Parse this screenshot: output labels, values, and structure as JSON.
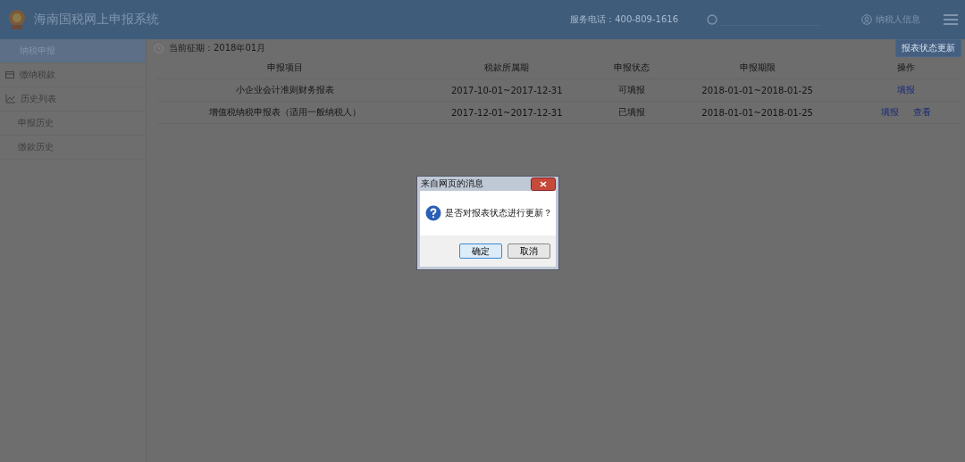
{
  "header": {
    "title": "海南国税网上申报系统",
    "service_phone": "服务电话：400-809-1616",
    "user_label": "纳税人信息"
  },
  "sidebar": {
    "items": [
      {
        "label": "纳税申报",
        "selected": true
      },
      {
        "label": "缴纳税款",
        "selected": false
      },
      {
        "label": "历史列表",
        "selected": false,
        "children": [
          {
            "label": "申报历史",
            "selected": false
          },
          {
            "label": "缴款历史",
            "selected": false
          }
        ]
      }
    ]
  },
  "period": "当前征期：2018年01月",
  "update_button": "报表状态更新",
  "table": {
    "columns": [
      "申报项目",
      "税款所属期",
      "申报状态",
      "申报期限",
      "操作"
    ],
    "rows": [
      {
        "cells": [
          "小企业会计准则财务报表",
          "2017-10-01~2017-12-31",
          "可填报",
          "2018-01-01~2018-01-25"
        ],
        "actions": [
          "填报"
        ]
      },
      {
        "cells": [
          "增值税纳税申报表（适用一般纳税人）",
          "2017-12-01~2017-12-31",
          "已填报",
          "2018-01-01~2018-01-25"
        ],
        "actions": [
          "填报",
          "查看"
        ]
      }
    ]
  },
  "dialog": {
    "title": "来自网页的消息",
    "message": "是否对报表状态进行更新？",
    "buttons": [
      {
        "label": "确定",
        "selected": true
      },
      {
        "label": "取消",
        "selected": false
      }
    ]
  }
}
